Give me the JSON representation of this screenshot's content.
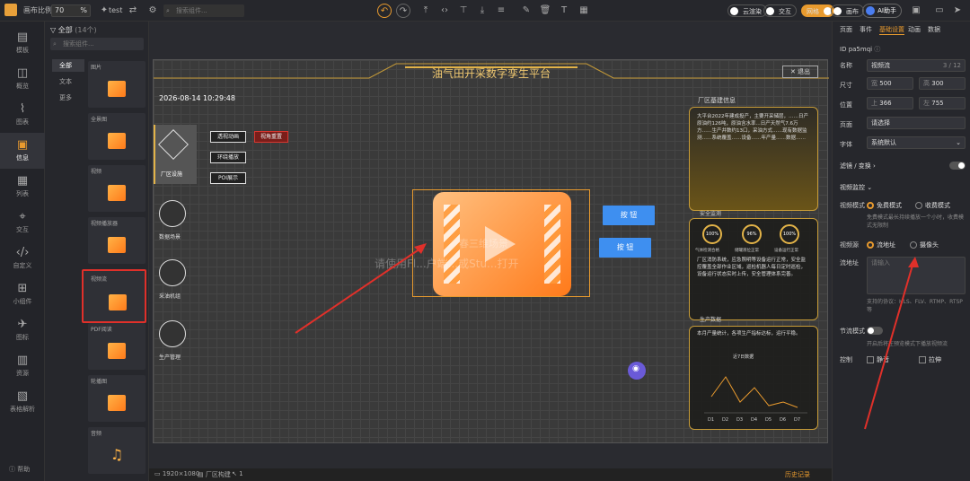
{
  "topbar": {
    "canvas_scale_label": "画布比例",
    "scale_value": "70",
    "scale_unit": "%",
    "project_name": "test",
    "search_placeholder": "搜索组件...",
    "toggles": [
      {
        "label": "云渲染"
      },
      {
        "label": "交互"
      },
      {
        "label": "网格"
      },
      {
        "label": "画布"
      }
    ],
    "ai_label": "AI助手"
  },
  "leftnav": {
    "items": [
      {
        "label": "模板"
      },
      {
        "label": "概览"
      },
      {
        "label": "图表"
      },
      {
        "label": "信息"
      },
      {
        "label": "列表"
      },
      {
        "label": "交互"
      },
      {
        "label": "自定义"
      },
      {
        "label": "小组件"
      },
      {
        "label": "图标"
      },
      {
        "label": "资源"
      },
      {
        "label": "表格解析"
      }
    ],
    "help": "帮助"
  },
  "library": {
    "title": "全部",
    "count": "(14个)",
    "search_placeholder": "搜索组件...",
    "categories": [
      "全部",
      "文本",
      "更多"
    ],
    "components": [
      "图片",
      "全景图",
      "视频",
      "视频播放器",
      "视频流",
      "PDF阅读",
      "轮播图",
      "音频"
    ]
  },
  "screen": {
    "title": "油气田开采数字孪生平台",
    "exit": "退出",
    "datetime": "2026-08-14 10:29:48",
    "left_items": [
      "厂区设施",
      "数据场景",
      "采油机组",
      "生产管理"
    ],
    "small_buttons": [
      "透视动画",
      "环绕播放",
      "POI展示"
    ],
    "red_button": "视角重置",
    "center_overlay1": "春三维场景",
    "center_overlay2": "请使用Fl...户端...或Stu...打开",
    "buttons": [
      "按 钮",
      "按 钮"
    ],
    "panel1_title": "厂区基建信息",
    "panel1_text": "大平台2022年建成投产，主要开采储层，……日产原油约126吨，原油含水率...日产天然气7.6万方……生产井数约13口，采油方式……现有数据监测……系统覆盖……设备……年产量……数据……",
    "panel2_title": "安全监测",
    "gauges": [
      "100%",
      "96%",
      "100%"
    ],
    "gauge_labels": [
      "气体检测合格",
      "储罐液位正常",
      "设备运行正常"
    ],
    "panel2_text": "厂区消防系统，应急照明等设备运行正常，安全监控覆盖全部作业区域，巡检机器人每日定时巡检，设备运行状态实时上传，安全管理体系完善。",
    "panel3_title": "生产数据",
    "panel3_text": "本月产量统计，各项生产指标达标，运行平稳。",
    "chart_title": "近7日数据",
    "chart_xlabels": [
      "D1",
      "D2",
      "D3",
      "D4",
      "D5",
      "D6",
      "D7"
    ]
  },
  "status": {
    "resolution": "1920×1080",
    "layer": "厂区构建",
    "count": "1",
    "history": "历史记录"
  },
  "right": {
    "tabs": [
      "页面",
      "事件",
      "基础设置",
      "动画",
      "数据"
    ],
    "id_label": "ID",
    "id_value": "pa5mqi",
    "name_label": "名称",
    "name_value": "视频流",
    "name_count": "3 / 12",
    "size_label": "尺寸",
    "w_label": "宽",
    "w_value": "500",
    "h_label": "高",
    "h_value": "300",
    "pos_label": "位置",
    "x_label": "上",
    "x_value": "366",
    "y_label": "左",
    "y_value": "755",
    "page_label": "页面",
    "page_value": "请选择",
    "font_label": "字体",
    "font_value": "系统默认",
    "filter_label": "滤镜 / 变换",
    "monitor_title": "视频监控",
    "mode_label": "视频模式",
    "mode_free": "免费模式",
    "mode_paid": "收费模式",
    "mode_hint": "免费模式最长持续播放一个小时，收费模式无限制",
    "source_label": "视频源",
    "source_url": "流地址",
    "source_cam": "摄像头",
    "stream_label": "流地址",
    "stream_placeholder": "请输入",
    "stream_hint": "支持的协议：HLS、FLV、RTMP、RTSP等",
    "save_label": "节流模式",
    "save_hint": "开启后将在预览模式下播放视频流",
    "control_label": "控制",
    "mute": "静音",
    "stretch": "拉伸"
  },
  "colors": {
    "accent": "#e89a2e",
    "gold": "#e2b348",
    "blue": "#3e8ff0",
    "red": "#d9362f"
  }
}
